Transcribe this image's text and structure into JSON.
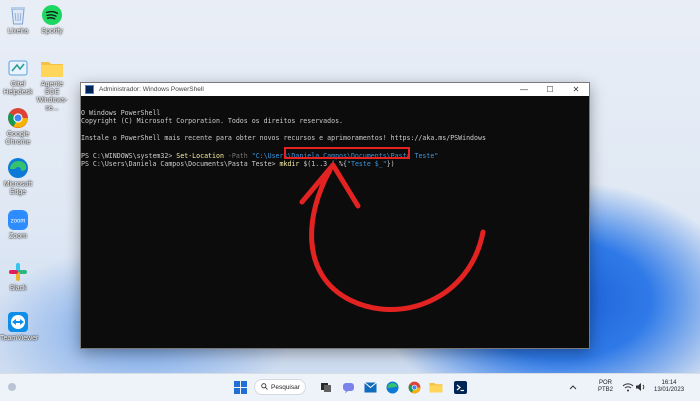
{
  "desktop_icons": [
    {
      "label": "Lixeira",
      "icon": "recycle-bin-icon"
    },
    {
      "label": "Spotify",
      "icon": "spotify-icon"
    },
    {
      "label": "Gitel Helpdesk",
      "icon": "helpdesk-icon"
    },
    {
      "label": "Agente SGE Windows-se...",
      "icon": "folder-icon"
    },
    {
      "label": "Google Chrome",
      "icon": "chrome-icon"
    },
    {
      "label": "Microsoft Edge",
      "icon": "edge-icon"
    },
    {
      "label": "Zoom",
      "icon": "zoom-icon"
    },
    {
      "label": "Slack",
      "icon": "slack-icon"
    },
    {
      "label": "TeamViewer",
      "icon": "teamviewer-icon"
    }
  ],
  "window": {
    "title": "Administrador: Windows PowerShell",
    "minimize": "—",
    "maximize": "☐",
    "close": "✕"
  },
  "terminal": {
    "line1": "O Windows PowerShell",
    "line2": "Copyright (C) Microsoft Corporation. Todos os direitos reservados.",
    "line3": "Instale o PowerShell mais recente para obter novos recursos e aprimoramentos! https://aka.ms/PSWindows",
    "cmd1_prompt": "PS C:\\WINDOWS\\system32> ",
    "cmd1_cmdlet": "Set-Location",
    "cmd1_param": " -Path ",
    "cmd1_value": "\"C:\\Users\\Daniela Campos\\Documents\\Pasta Teste\"",
    "cmd2_prompt": "PS C:\\Users\\Daniela Campos\\Documents\\Pasta Teste> ",
    "cmd2_cmdlet": "mkdir",
    "cmd2_range": " $(1..3 | %{",
    "cmd2_str": "\"Teste $_\"",
    "cmd2_end": "})"
  },
  "taskbar": {
    "search_label": "Pesquisar",
    "language": "POR",
    "layout": "PTB2",
    "time": "16:14",
    "date": "13/01/2023"
  },
  "colors": {
    "terminal_bg": "#0c0c0c",
    "highlight": "#e32222",
    "arrow": "#e32222"
  }
}
